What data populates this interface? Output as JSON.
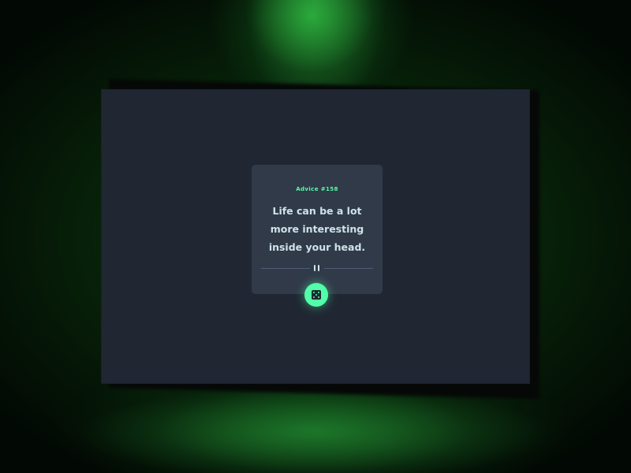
{
  "advice": {
    "id_label": "Advice #158",
    "quote": "Life can be a lot more interesting inside your head."
  },
  "icons": {
    "divider": "pause-icon",
    "generate_button": "dice-icon"
  },
  "colors": {
    "accent": "#52ffa8",
    "card_background": "#313a49",
    "screen_background": "#202733",
    "text": "#cee3e9",
    "ambient_light": "#1f9e2f"
  }
}
